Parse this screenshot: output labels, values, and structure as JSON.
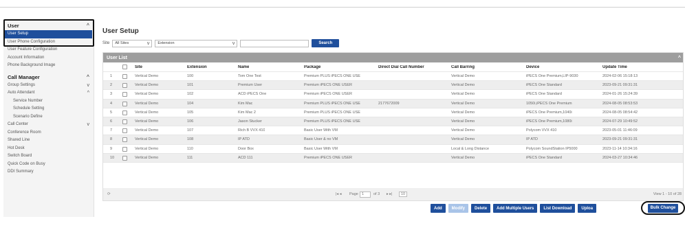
{
  "sidebar": {
    "user_section": "User",
    "user_items": [
      "User Setup",
      "User Phone Configuration",
      "User Feature Configuration",
      "Account Information",
      "Phone Background Image"
    ],
    "call_manager_section": "Call Manager",
    "cm_items": [
      {
        "label": "Group Settings",
        "sub": false,
        "chev": "v"
      },
      {
        "label": "Auto Attendant",
        "sub": false,
        "chev": "^"
      },
      {
        "label": "Service Number",
        "sub": true,
        "chev": ""
      },
      {
        "label": "Schedule Setting",
        "sub": true,
        "chev": ""
      },
      {
        "label": "Scenario Define",
        "sub": true,
        "chev": ""
      },
      {
        "label": "Call Center",
        "sub": false,
        "chev": "v"
      },
      {
        "label": "Conference Room",
        "sub": false,
        "chev": ""
      },
      {
        "label": "Shared Line",
        "sub": false,
        "chev": ""
      },
      {
        "label": "Hot Desk",
        "sub": false,
        "chev": ""
      },
      {
        "label": "Switch Board",
        "sub": false,
        "chev": ""
      },
      {
        "label": "Quick Code on Busy",
        "sub": false,
        "chev": ""
      },
      {
        "label": "DDI Summary",
        "sub": false,
        "chev": ""
      }
    ]
  },
  "page": {
    "title": "User Setup",
    "site_label": "Site",
    "site_value": "All Sites",
    "field_value": "Extension",
    "search_label": "Search"
  },
  "table": {
    "title": "User List",
    "headers": {
      "site": "Site",
      "extension": "Extension",
      "name": "Name",
      "package": "Package",
      "ddi": "Direct Dial Call Number",
      "barring": "Call Barring",
      "device": "Device",
      "updated": "Update Time"
    },
    "rows": [
      {
        "n": "1",
        "site": "Vertical Demo",
        "ext": "100",
        "name": "Tom One Test",
        "package": "Premium PLUS iPECS ONE USE",
        "ddi": "",
        "barring": "Vertical Demo",
        "device": "iPECS One Premium,LIP-9030",
        "updated": "2024-02-06 15:18:13"
      },
      {
        "n": "2",
        "site": "Vertical Demo",
        "ext": "101",
        "name": "Premium User",
        "package": "Premium iPECS ONE USER",
        "ddi": "",
        "barring": "Vertical Demo",
        "device": "iPECS One Standard",
        "updated": "2023-09-21 09:31:31"
      },
      {
        "n": "3",
        "site": "Vertical Demo",
        "ext": "102",
        "name": "ACD iPECS One",
        "package": "Premium iPECS ONE USER",
        "ddi": "",
        "barring": "Vertical Demo",
        "device": "iPECS One Standard",
        "updated": "2024-01-26 15:24:39"
      },
      {
        "n": "4",
        "site": "Vertical Demo",
        "ext": "104",
        "name": "Kim Mac",
        "package": "Premium PLUS iPECS ONE USE",
        "ddi": "2177672009",
        "barring": "Vertical Demo",
        "device": "1050i,iPECS One Premium",
        "updated": "2024-08-05 08:53:53"
      },
      {
        "n": "5",
        "site": "Vertical Demo",
        "ext": "105",
        "name": "Kim Mac 2",
        "package": "Premium PLUS iPECS ONE USE",
        "ddi": "",
        "barring": "Vertical Demo",
        "device": "iPECS One Premium,1040i",
        "updated": "2024-08-05 08:54:42"
      },
      {
        "n": "6",
        "site": "Vertical Demo",
        "ext": "106",
        "name": "Jason Stucker",
        "package": "Premium PLUS iPECS ONE USE",
        "ddi": "",
        "barring": "Vertical Demo",
        "device": "iPECS One Premium,1080i",
        "updated": "2024-07-29 10:49:52"
      },
      {
        "n": "7",
        "site": "Vertical Demo",
        "ext": "107",
        "name": "Rich B VVX 410",
        "package": "Basic User With VM",
        "ddi": "",
        "barring": "Vertical Demo",
        "device": "Polycom VVX 410",
        "updated": "2023-05-01 11:46:09"
      },
      {
        "n": "8",
        "site": "Vertical Demo",
        "ext": "108",
        "name": "IP ATD",
        "package": "Basic User & no VM",
        "ddi": "",
        "barring": "Vertical Demo",
        "device": "IP ATD",
        "updated": "2023-09-21 09:31:31"
      },
      {
        "n": "9",
        "site": "Vertical Demo",
        "ext": "110",
        "name": "Door Box",
        "package": "Basic User With VM",
        "ddi": "",
        "barring": "Local & Long Distance",
        "device": "Polycom SoundStation IP5000",
        "updated": "2023-11-14 10:34:16"
      },
      {
        "n": "10",
        "site": "Vertical Demo",
        "ext": "111",
        "name": "ACD 111",
        "package": "Premium iPECS ONE USER",
        "ddi": "",
        "barring": "Vertical Demo",
        "device": "iPECS One Standard",
        "updated": "2024-03-27 10:34:46"
      }
    ],
    "pager": {
      "page_label": "Page",
      "page_value": "1",
      "of": "of 3",
      "per_page": "10",
      "view": "View 1 - 10 of 28"
    }
  },
  "actions": {
    "add": "Add",
    "modify": "Modify",
    "delete": "Delete",
    "add_multiple": "Add Multiple Users",
    "list_download": "List Download",
    "upload": "Uploa",
    "bulk_change": "Bulk Change"
  },
  "colors": {
    "primary": "#1f4f9c",
    "header_gray": "#9e9e9e",
    "disabled": "#a9c4e8"
  }
}
